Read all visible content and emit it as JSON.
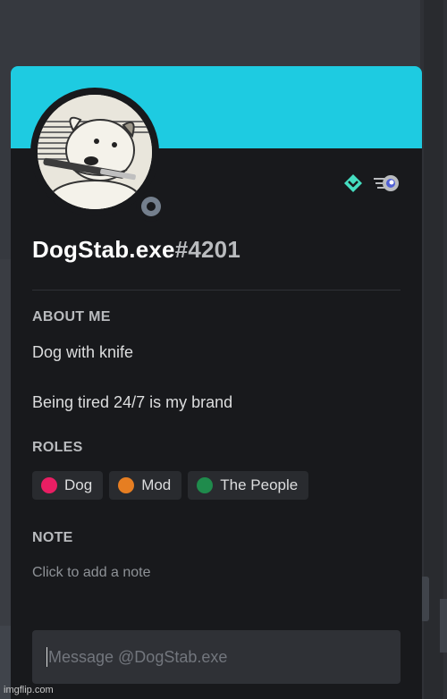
{
  "profile": {
    "username": "DogStab.exe",
    "discriminator": "#4201",
    "status": "offline",
    "avatar_description": "dog-holding-knife"
  },
  "badges": [
    "hypesquad-balance-icon",
    "nitro-boost-icon"
  ],
  "about": {
    "title": "ABOUT ME",
    "line1": "Dog with knife",
    "line2": "Being tired 24/7 is my brand"
  },
  "roles": {
    "title": "ROLES",
    "items": [
      {
        "label": "Dog",
        "color": "#e91e63"
      },
      {
        "label": "Mod",
        "color": "#e67e22"
      },
      {
        "label": "The People",
        "color": "#1f8b4c"
      }
    ]
  },
  "note": {
    "title": "NOTE",
    "placeholder": "Click to add a note"
  },
  "message": {
    "placeholder": "Message @DogStab.exe"
  },
  "watermark": "imgflip.com",
  "colors": {
    "banner": "#1ecbe1",
    "card_bg": "#18191c",
    "status_offline": "#747f8d"
  }
}
